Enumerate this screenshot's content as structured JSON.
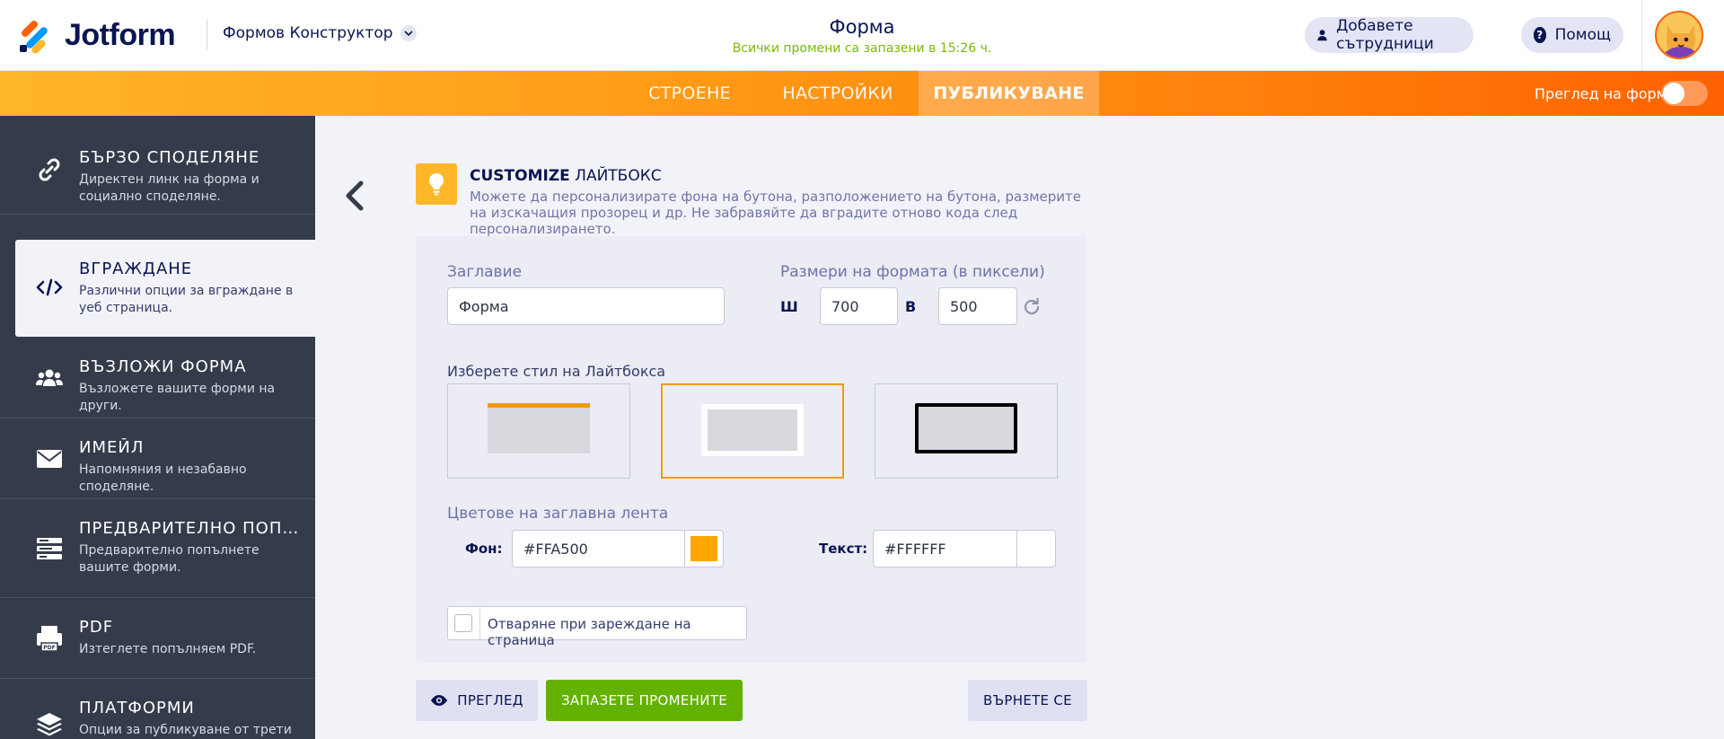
{
  "app": {
    "logo_text": "Jotform",
    "builder_label": "Формов Конструктор",
    "form_title": "Форма",
    "saved_status": "Всички промени са запазени в 15:26 ч.",
    "add_collaborators": "Добавете сътрудници",
    "help": "Помощ"
  },
  "nav": {
    "tabs": [
      "СТРОЕНЕ",
      "НАСТРОЙКИ",
      "ПУБЛИКУВАНЕ"
    ],
    "active_tab": "ПУБЛИКУВАНЕ",
    "form_preview_label": "Преглед на форма",
    "form_preview_on": false
  },
  "sidebar": {
    "items": [
      {
        "title": "БЪРЗО СПОДЕЛЯНЕ",
        "desc": "Директен линк на форма и социално споделяне.",
        "icon": "link-icon"
      },
      {
        "title": "ВГРАЖДАНЕ",
        "desc": "Различни опции за вграждане в уеб страница.",
        "icon": "code-icon",
        "active": true
      },
      {
        "title": "ВЪЗЛОЖИ ФОРМА",
        "desc": "Възложете вашите форми на други.",
        "icon": "users-icon"
      },
      {
        "title": "ИМЕЙЛ",
        "desc": "Напомняния и незабавно споделяне.",
        "icon": "envelope-icon"
      },
      {
        "title": "ПРЕДВАРИТЕЛНО ПОПЪЛВАНЕ",
        "desc": "Предварително попълнете вашите форми.",
        "icon": "prefill-icon"
      },
      {
        "title": "PDF",
        "desc": "Изтеглете попълняем PDF.",
        "icon": "pdf-icon"
      },
      {
        "title": "ПЛАТФОРМИ",
        "desc": "Опции за публикуване от трети страни.",
        "icon": "layers-icon"
      }
    ]
  },
  "content": {
    "hint_title_bold": "CUSTOMIZE",
    "hint_title_rest": "ЛАЙТБОКС",
    "hint_desc": "Можете да персонализирате фона на бутона, разположението на бутона, размерите на изскачащия прозорец и др. Не забравяйте да вградите отново кода след персонализирането.",
    "title_label": "Заглавие",
    "title_value": "Форма",
    "size_label": "Размери на формата (в пиксели)",
    "width_letter": "Ш",
    "width_value": "700",
    "height_letter": "В",
    "height_value": "500",
    "style_label": "Изберете стил на Лайтбокса",
    "selected_style": 2,
    "colors_label": "Цветове на заглавна лента",
    "bg_label": "Фон:",
    "bg_value": "#FFA500",
    "text_label": "Текст:",
    "text_value": "#FFFFFF",
    "open_on_load_label": "Отваряне при зареждане на страница",
    "open_on_load_checked": false
  },
  "buttons": {
    "preview": "ПРЕГЛЕД",
    "save": "ЗАПАЗЕТЕ ПРОМЕНИТЕ",
    "revert": "ВЪРНЕТЕ СЕ"
  },
  "colors": {
    "accent_orange": "#ff6100",
    "hint_yellow": "#ffb629",
    "save_green": "#64b200",
    "sidebar_bg": "#343c4b",
    "swatch_bg": "#FFA500",
    "swatch_text": "#FFFFFF"
  }
}
